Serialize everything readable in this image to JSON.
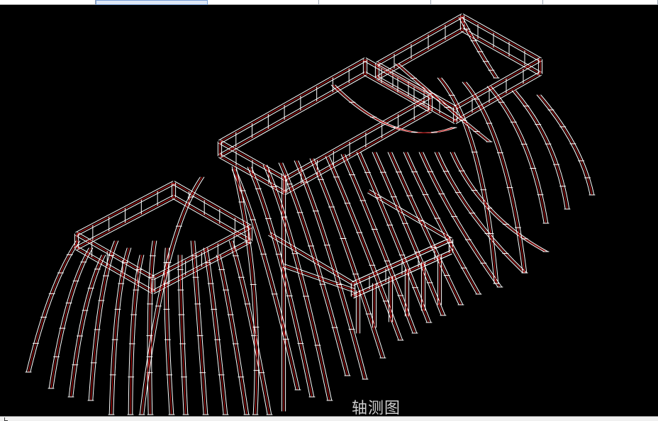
{
  "window": {
    "caption": "轴测图"
  },
  "top_strip": {
    "cells": [
      "",
      "",
      "",
      "",
      "",
      "",
      "",
      "",
      ""
    ],
    "selected_index": 1
  },
  "canvas": {
    "background": "#000000",
    "frame_color": "#ffffff",
    "centerline_color": "#c00000"
  },
  "icons": {
    "cursor_tick": "crosshair-tick-icon"
  }
}
